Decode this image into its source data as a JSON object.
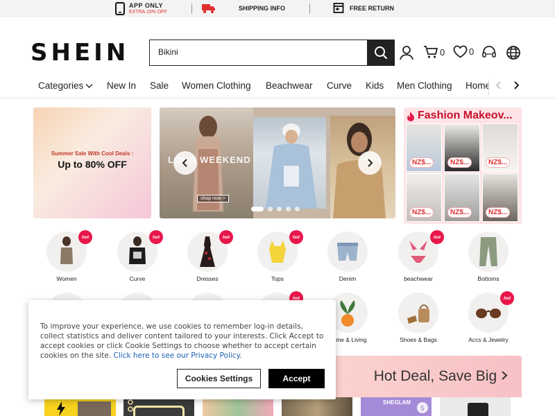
{
  "topbar": {
    "app_title": "APP ONLY",
    "app_sub": "EXTRA 15% OFF",
    "shipping": "SHIPPING INFO",
    "return": "FREE  RETURN"
  },
  "header": {
    "logo": "SHEIN",
    "search_value": "Bikini",
    "cart_count": "0",
    "wishlist_count": "0"
  },
  "nav": {
    "items": [
      "Categories",
      "New In",
      "Sale",
      "Women Clothing",
      "Beachwear",
      "Curve",
      "Kids",
      "Men Clothing",
      "Home"
    ]
  },
  "promo_left": {
    "line1": "Summer Sale With Cool Deals :",
    "line2": "Up to 80% OFF"
  },
  "carousel": {
    "overlay_text": "LONG WEEKEND",
    "shop_now": "shop now >"
  },
  "fashion": {
    "title": "Fashion Makeov...",
    "prices": [
      "NZ$...",
      "NZ$...",
      "NZ$...",
      "NZ$...",
      "NZ$...",
      "NZ$..."
    ]
  },
  "categories_row1": [
    {
      "label": "Women",
      "hot": true
    },
    {
      "label": "Curve",
      "hot": true
    },
    {
      "label": "Dresses",
      "hot": true
    },
    {
      "label": "Tops",
      "hot": true
    },
    {
      "label": "Denim",
      "hot": false
    },
    {
      "label": "beachwear",
      "hot": true
    },
    {
      "label": "Bottoms",
      "hot": false
    }
  ],
  "categories_row2": [
    {
      "label": "Home & Living",
      "hot": false
    },
    {
      "label": "Shoes & Bags",
      "hot": false
    },
    {
      "label": "Accs & Jewelry",
      "hot": true
    }
  ],
  "hot_badge": "hot",
  "deal": {
    "title": "Hot Deal, Save Big"
  },
  "strip": {
    "brand": "SHEGLAM"
  },
  "cookie": {
    "text": "To improve your experience, we use cookies to remember log-in details, collect statistics and deliver content tailored to your interests. Click Accept to accept cookies or click Cookie Settings to choose whether to accept certain cookies on the site.",
    "link": "Click here to see our Privacy Policy",
    "period": ".",
    "settings_label": "Cookies Settings",
    "accept_label": "Accept"
  },
  "colors": {
    "brand_dark": "#222222",
    "accent_red": "#e03030",
    "hot_pink": "#e8174b",
    "link_blue": "#1c5fb0"
  }
}
